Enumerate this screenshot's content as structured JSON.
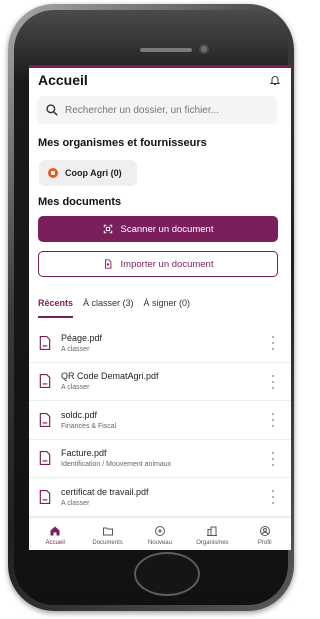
{
  "header": {
    "title": "Accueil",
    "notification_icon": "bell-icon"
  },
  "search": {
    "placeholder": "Rechercher un dossier, un fichier..."
  },
  "organisations": {
    "title": "Mes organismes et fournisseurs",
    "items": [
      {
        "label": "Coop Agri (0)",
        "logo": "coop-agri-logo"
      }
    ]
  },
  "documents": {
    "title": "Mes documents",
    "scan_label": "Scanner un document",
    "import_label": "Importer un document"
  },
  "tabs": [
    {
      "label": "Récents",
      "active": true
    },
    {
      "label": "À classer (3)",
      "active": false
    },
    {
      "label": "À signer (0)",
      "active": false
    }
  ],
  "recent_documents": [
    {
      "name": "Péage.pdf",
      "category": "A classer"
    },
    {
      "name": "QR Code DematAgri.pdf",
      "category": "A classer"
    },
    {
      "name": "soldc.pdf",
      "category": "Finances & Fiscal"
    },
    {
      "name": "Facture.pdf",
      "category": "Identification / Mouvement animaux"
    },
    {
      "name": "certificat de travail.pdf",
      "category": "A classer"
    }
  ],
  "bottom_nav": [
    {
      "label": "Accueil",
      "icon": "home-icon",
      "active": true
    },
    {
      "label": "Documents",
      "icon": "folder-icon",
      "active": false
    },
    {
      "label": "Nouveau",
      "icon": "plus-circle-icon",
      "active": false
    },
    {
      "label": "Organismes",
      "icon": "building-icon",
      "active": false
    },
    {
      "label": "Profil",
      "icon": "profile-icon",
      "active": false
    }
  ],
  "colors": {
    "accent": "#7a1f5c",
    "background": "#ffffff"
  }
}
